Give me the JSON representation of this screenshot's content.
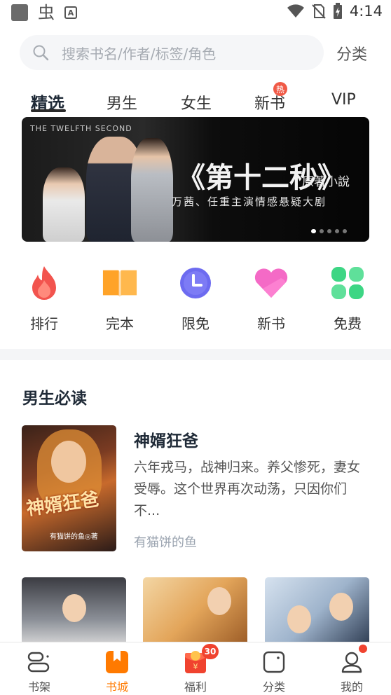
{
  "status_bar": {
    "time": "4:14"
  },
  "search": {
    "placeholder": "搜索书名/作者/标签/角色",
    "category_link": "分类"
  },
  "tabs": [
    {
      "label": "精选"
    },
    {
      "label": "男生"
    },
    {
      "label": "女生"
    },
    {
      "label": "新书",
      "badge": "热"
    },
    {
      "label": "VIP"
    }
  ],
  "banner": {
    "english_title": "THE TWELFTH SECOND",
    "title": "《第十二秒》",
    "subtitle": "原著小說",
    "cast_line": "万茜、任重主演情感悬疑大剧"
  },
  "quick_links": [
    {
      "label": "排行",
      "icon": "flame-icon"
    },
    {
      "label": "完本",
      "icon": "book-icon"
    },
    {
      "label": "限免",
      "icon": "clock-icon"
    },
    {
      "label": "新书",
      "icon": "heart-icon"
    },
    {
      "label": "免费",
      "icon": "clover-icon"
    }
  ],
  "section": {
    "title": "男生必读",
    "featured": {
      "title": "神婿狂爸",
      "description": "六年戎马，战神归来。养父惨死，妻女受辱。这个世界再次动荡，只因你们不...",
      "author": "有猫饼的鱼",
      "cover_title": "神婿狂爸",
      "cover_author": "有猫饼的鱼◎著"
    }
  },
  "bottom_nav": [
    {
      "label": "书架"
    },
    {
      "label": "书城"
    },
    {
      "label": "福利",
      "badge": "30"
    },
    {
      "label": "分类"
    },
    {
      "label": "我的"
    }
  ],
  "colors": {
    "accent": "#ff7a00",
    "badge": "#f0432f"
  }
}
